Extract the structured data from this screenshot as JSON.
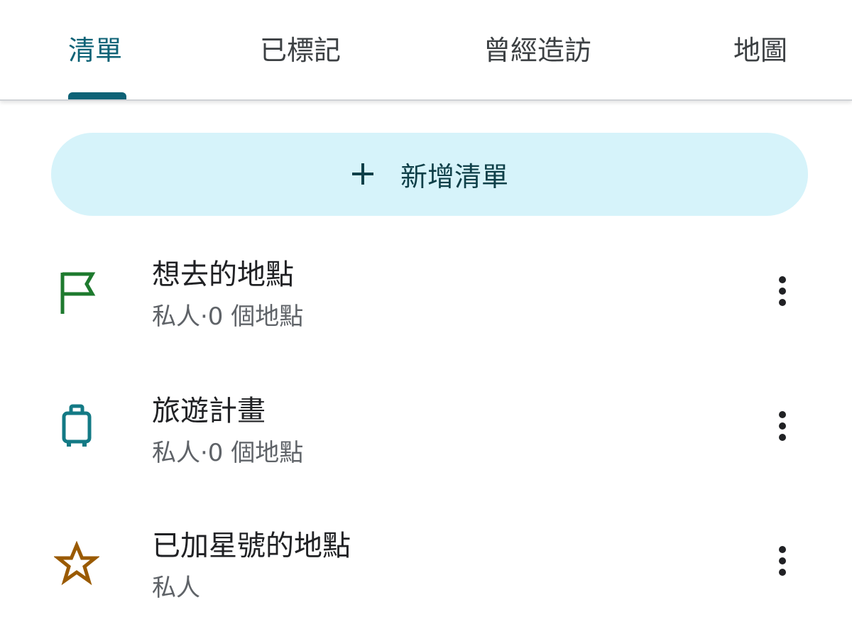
{
  "tabs": [
    {
      "label": "清單",
      "active": true
    },
    {
      "label": "已標記",
      "active": false
    },
    {
      "label": "曾經造訪",
      "active": false
    },
    {
      "label": "地圖",
      "active": false
    }
  ],
  "new_list": {
    "icon": "plus-icon",
    "label": "新增清單"
  },
  "lists": [
    {
      "title": "想去的地點",
      "subtitle": "私人·0 個地點",
      "icon": "flag-icon",
      "icon_color": "#1e7a2e"
    },
    {
      "title": "旅遊計畫",
      "subtitle": "私人·0 個地點",
      "icon": "suitcase-icon",
      "icon_color": "#137a85"
    },
    {
      "title": "已加星號的地點",
      "subtitle": "私人",
      "icon": "star-icon",
      "icon_color": "#9a5a00"
    }
  ],
  "colors": {
    "accent": "#0d6276",
    "button_bg": "#d6f3fa"
  }
}
